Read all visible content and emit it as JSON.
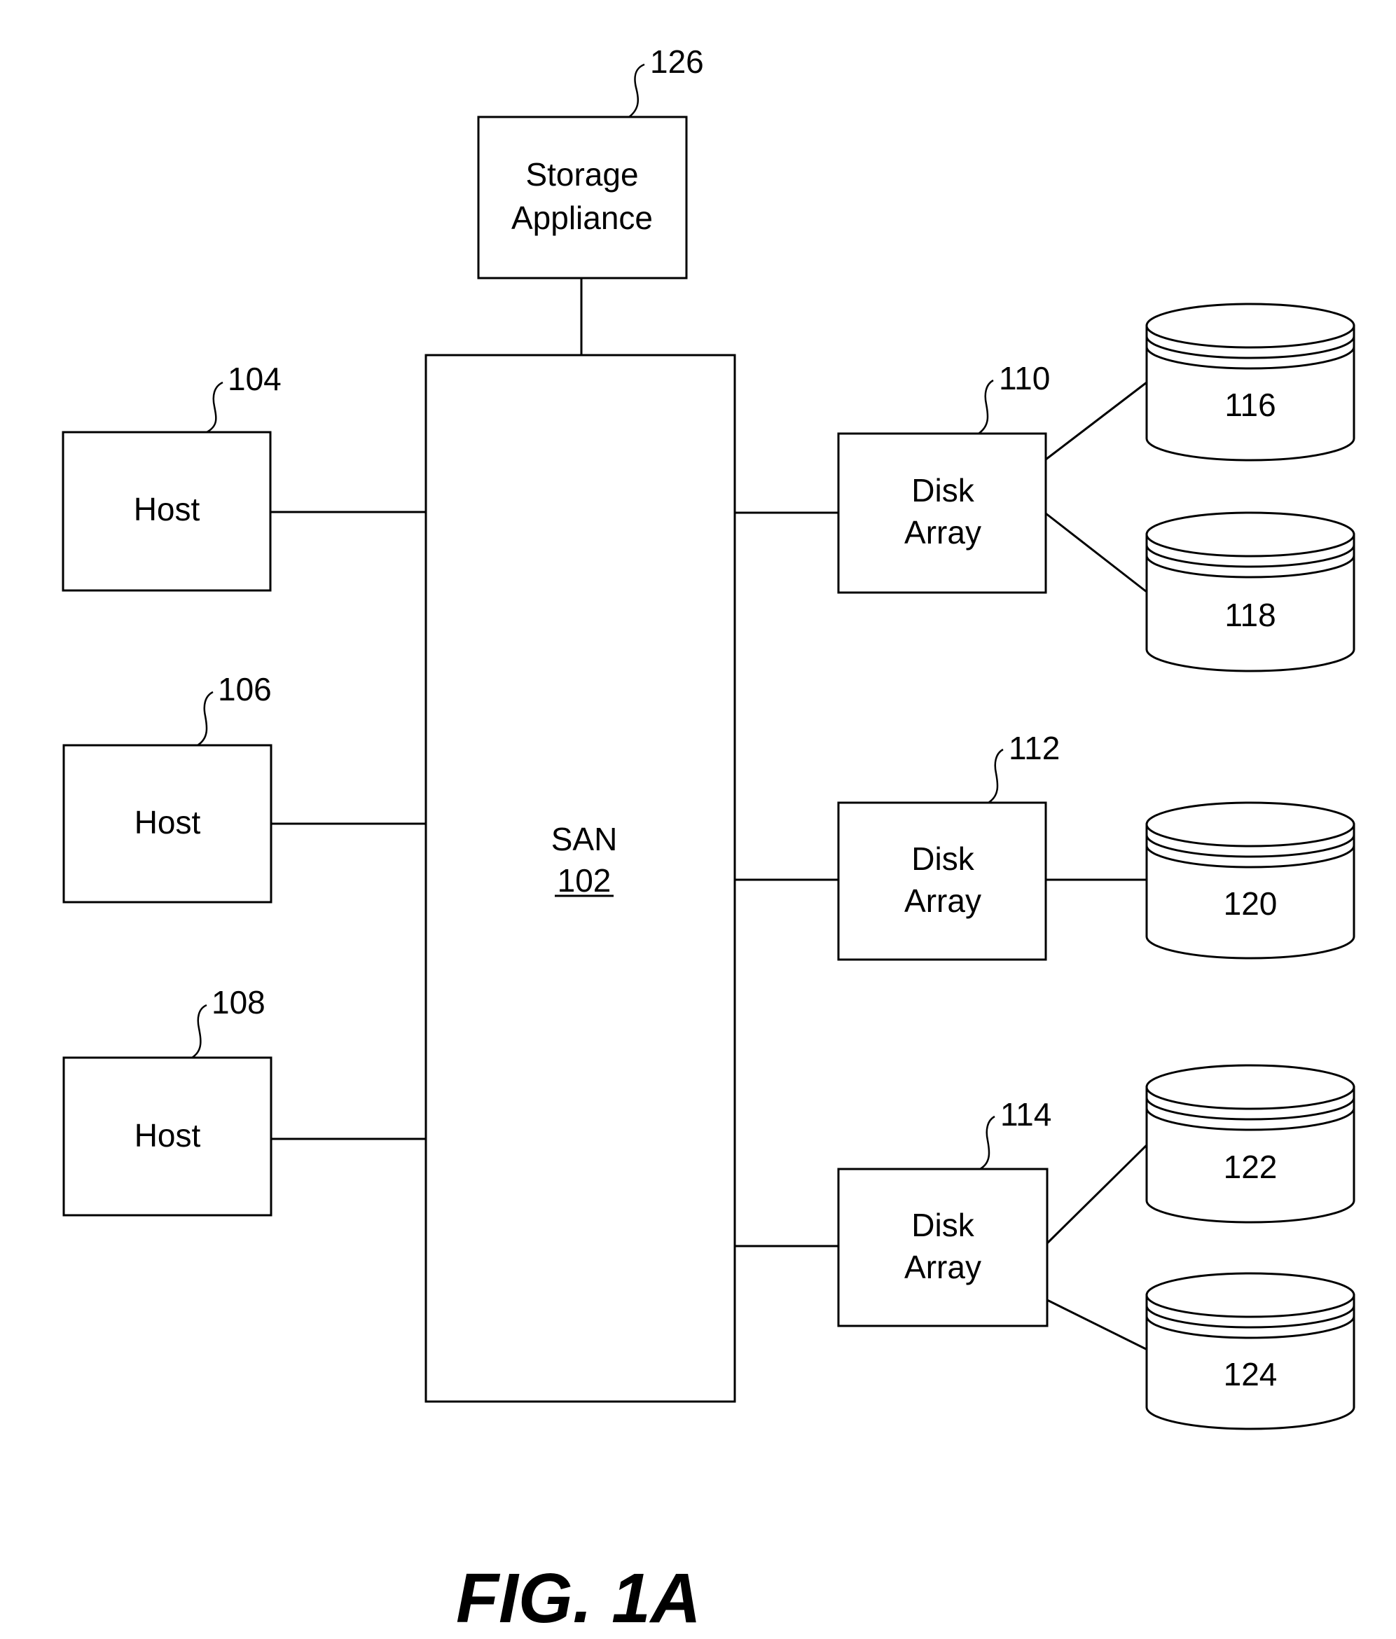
{
  "figure": {
    "caption": "FIG. 1A"
  },
  "storage_appliance": {
    "line1": "Storage",
    "line2": "Appliance",
    "ref": "126"
  },
  "san": {
    "label": "SAN",
    "ref": "102"
  },
  "hosts": [
    {
      "label": "Host",
      "ref": "104"
    },
    {
      "label": "Host",
      "ref": "106"
    },
    {
      "label": "Host",
      "ref": "108"
    }
  ],
  "disk_arrays": [
    {
      "line1": "Disk",
      "line2": "Array",
      "ref": "110",
      "disks": [
        "116",
        "118"
      ]
    },
    {
      "line1": "Disk",
      "line2": "Array",
      "ref": "112",
      "disks": [
        "120"
      ]
    },
    {
      "line1": "Disk",
      "line2": "Array",
      "ref": "114",
      "disks": [
        "122",
        "124"
      ]
    }
  ],
  "disks": [
    {
      "label": "116"
    },
    {
      "label": "118"
    },
    {
      "label": "120"
    },
    {
      "label": "122"
    },
    {
      "label": "124"
    }
  ],
  "colors": {
    "line": "#000000",
    "background": "#ffffff"
  }
}
